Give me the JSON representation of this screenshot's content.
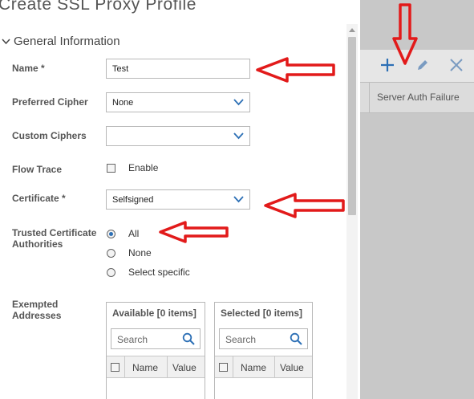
{
  "dialog": {
    "title": "Create SSL Proxy Profile",
    "section": "General Information",
    "name_label": "Name *",
    "name_value": "Test",
    "preferred_cipher_label": "Preferred Cipher",
    "preferred_cipher_value": "None",
    "custom_ciphers_label": "Custom Ciphers",
    "custom_ciphers_value": "",
    "flow_trace_label": "Flow Trace",
    "flow_trace_option": "Enable",
    "certificate_label": "Certificate *",
    "certificate_value": "Selfsigned",
    "trusted_ca_label": "Trusted Certificate Authorities",
    "trusted_ca_options": [
      "All",
      "None",
      "Select specific"
    ],
    "trusted_ca_selected": "All",
    "exempted_label": "Exempted Addresses",
    "available": {
      "title": "Available  [0 items]",
      "search_placeholder": "Search",
      "col_name": "Name",
      "col_value": "Value"
    },
    "selected": {
      "title": "Selected  [0 items]",
      "search_placeholder": "Search",
      "col_name": "Name",
      "col_value": "Value"
    }
  },
  "background": {
    "column_header": "Server Auth Failure",
    "toolbar_icons": [
      "plus-icon",
      "pencil-icon",
      "close-icon"
    ]
  },
  "colors": {
    "accent": "#2c6fb5",
    "annotation_red": "#e21a1a",
    "overlay_gray": "#c8c8c8"
  }
}
